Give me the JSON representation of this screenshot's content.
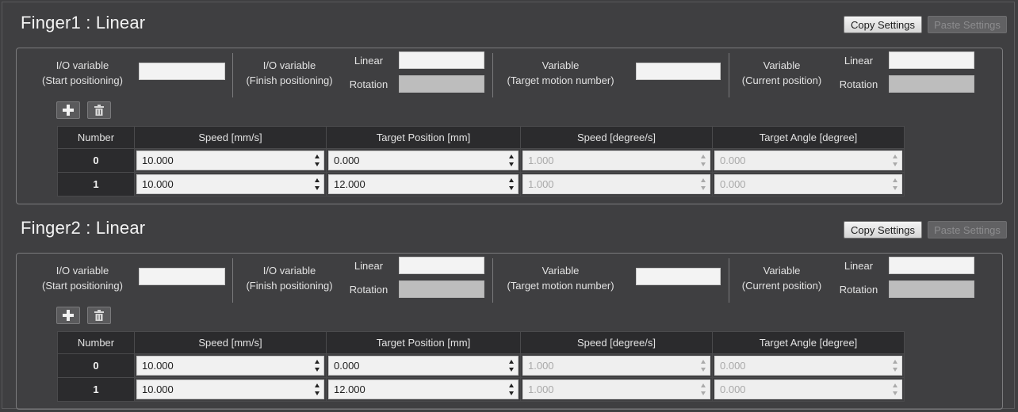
{
  "window": {
    "colors": {
      "background": "#3f3f41",
      "panel_border": "#7b7b7d",
      "header_bg": "#2b2b2d"
    }
  },
  "buttons": {
    "copy": "Copy Settings",
    "paste": "Paste Settings"
  },
  "labels": {
    "io_variable": "I/O variable",
    "start_positioning": "(Start positioning)",
    "finish_positioning": "(Finish positioning)",
    "linear": "Linear",
    "rotation": "Rotation",
    "variable": "Variable",
    "target_motion_number": "(Target motion number)",
    "current_position": "(Current position)"
  },
  "icons": {
    "add": "plus-icon",
    "delete": "trash-icon",
    "spinner": "up-down-arrows-icon"
  },
  "table": {
    "columns": [
      "Number",
      "Speed [mm/s]",
      "Target Position [mm]",
      "Speed [degree/s]",
      "Target Angle [degree]"
    ]
  },
  "fingers": [
    {
      "title": "Finger1 : Linear",
      "fields": {
        "start": "",
        "finish_linear": "",
        "finish_rotation": "",
        "target_motion": "",
        "current_linear": "",
        "current_rotation": ""
      },
      "rows": [
        {
          "number": "0",
          "speed_mm": "10.000",
          "target_pos": "0.000",
          "speed_deg": "1.000",
          "target_angle": "0.000"
        },
        {
          "number": "1",
          "speed_mm": "10.000",
          "target_pos": "12.000",
          "speed_deg": "1.000",
          "target_angle": "0.000"
        }
      ]
    },
    {
      "title": "Finger2 : Linear",
      "fields": {
        "start": "",
        "finish_linear": "",
        "finish_rotation": "",
        "target_motion": "",
        "current_linear": "",
        "current_rotation": ""
      },
      "rows": [
        {
          "number": "0",
          "speed_mm": "10.000",
          "target_pos": "0.000",
          "speed_deg": "1.000",
          "target_angle": "0.000"
        },
        {
          "number": "1",
          "speed_mm": "10.000",
          "target_pos": "12.000",
          "speed_deg": "1.000",
          "target_angle": "0.000"
        }
      ]
    }
  ]
}
